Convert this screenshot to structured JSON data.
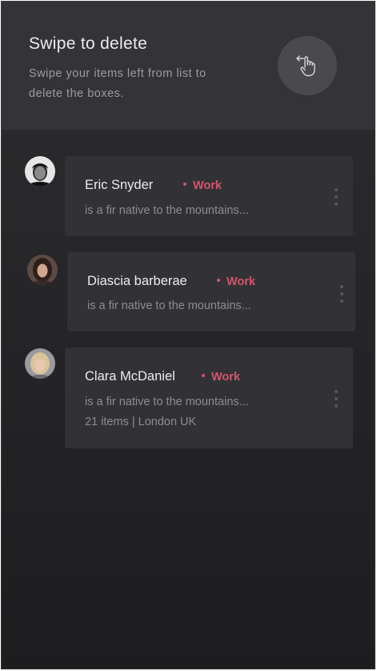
{
  "header": {
    "title": "Swipe to delete",
    "subtitle": "Swipe your items left from list to delete the boxes.",
    "action_icon": "swipe-left-hand-icon"
  },
  "colors": {
    "tag": "#d4546c",
    "card": "#323236",
    "header": "#343438"
  },
  "items": [
    {
      "name": "Eric Snyder",
      "tag": "Work",
      "description": "is a fir native to the mountains...",
      "meta": ""
    },
    {
      "name": "Diascia barberae",
      "tag": "Work",
      "description": "is a fir native to the mountains...",
      "meta": ""
    },
    {
      "name": "Clara McDaniel",
      "tag": "Work",
      "description": "is a fir native to the mountains...",
      "meta": "21 items | London UK"
    }
  ]
}
